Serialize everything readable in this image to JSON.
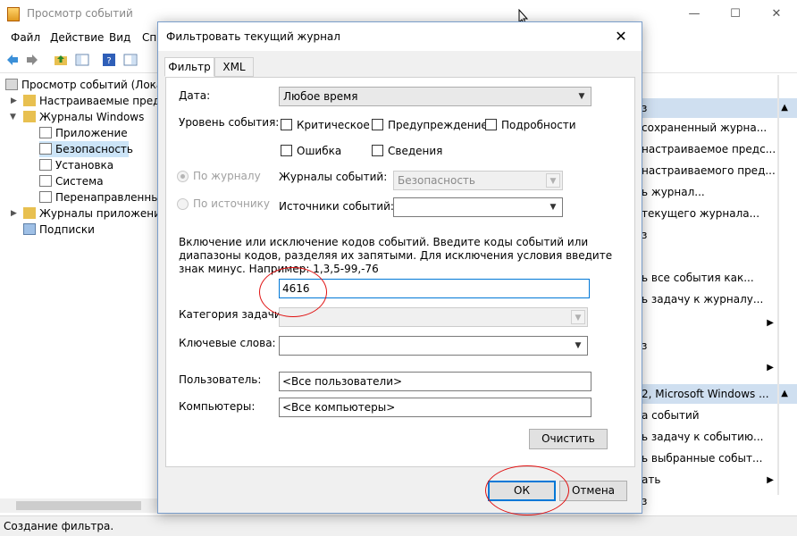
{
  "main_window": {
    "title": "Просмотр событий",
    "controls": {
      "minimize": "—",
      "maximize": "☐",
      "close": "✕"
    }
  },
  "menubar": [
    "Файл",
    "Действие",
    "Вид",
    "Спр"
  ],
  "toolbar_icons": [
    "back-icon",
    "forward-icon",
    "folder-up-icon",
    "show-hide-tree-icon",
    "help-icon",
    "show-hide-action-icon"
  ],
  "tree": {
    "items": [
      {
        "label": "Просмотр событий (Локал",
        "icon": "event-viewer-icon"
      },
      {
        "label": "Настраиваемые предста",
        "icon": "folder-icon"
      },
      {
        "label": "Журналы Windows",
        "icon": "folder-icon"
      },
      {
        "label": "Приложение",
        "icon": "log-icon"
      },
      {
        "label": "Безопасность",
        "icon": "log-icon"
      },
      {
        "label": "Установка",
        "icon": "log-icon"
      },
      {
        "label": "Система",
        "icon": "log-icon"
      },
      {
        "label": "Перенаправленные",
        "icon": "log-icon"
      },
      {
        "label": "Журналы приложений",
        "icon": "folder-icon"
      },
      {
        "label": "Подписки",
        "icon": "subscription-icon"
      }
    ]
  },
  "actions": {
    "header1": "з",
    "rows1": [
      "сохраненный журна...",
      "настраиваемое предс...",
      "настраиваемого пред...",
      "ь журнал...",
      "текущего журнала...",
      "з",
      "ь все события как...",
      "ь задачу к журналу...",
      "",
      "з",
      ""
    ],
    "header2": "2, Microsoft Windows ...",
    "rows2": [
      "а событий",
      "ь задачу к событию...",
      "ь выбранные событ...",
      "ать",
      "з"
    ]
  },
  "status": "Создание фильтра.",
  "dialog": {
    "title": "Фильтровать текущий журнал",
    "close": "✕",
    "tabs": [
      "Фильтр",
      "XML"
    ],
    "date_label": "Дата:",
    "date_value": "Любое время",
    "level_label": "Уровень события:",
    "levels": {
      "critical": "Критическое",
      "warning": "Предупреждение",
      "verbose": "Подробности",
      "error": "Ошибка",
      "info": "Сведения"
    },
    "by_log": "По журналу",
    "by_source": "По источнику",
    "logs_label": "Журналы событий:",
    "logs_value": "Безопасность",
    "sources_label": "Источники событий:",
    "sources_value": "",
    "description": "Включение или исключение кодов событий. Введите коды событий или диапазоны кодов, разделяя их запятыми. Для исключения условия введите знак минус. Например: 1,3,5-99,-76",
    "event_ids": "4616",
    "task_category_label": "Категория задачи:",
    "keywords_label": "Ключевые слова:",
    "user_label": "Пользователь:",
    "user_value": "<Все пользователи>",
    "computer_label": "Компьютеры:",
    "computer_value": "<Все компьютеры>",
    "clear_button": "Очистить",
    "ok_button": "ОК",
    "cancel_button": "Отмена"
  },
  "colors": {
    "selection": "#cce4f7",
    "actions_header": "#cfdff0",
    "annotation_circle": "#e01010",
    "focus_border": "#0078d7"
  }
}
